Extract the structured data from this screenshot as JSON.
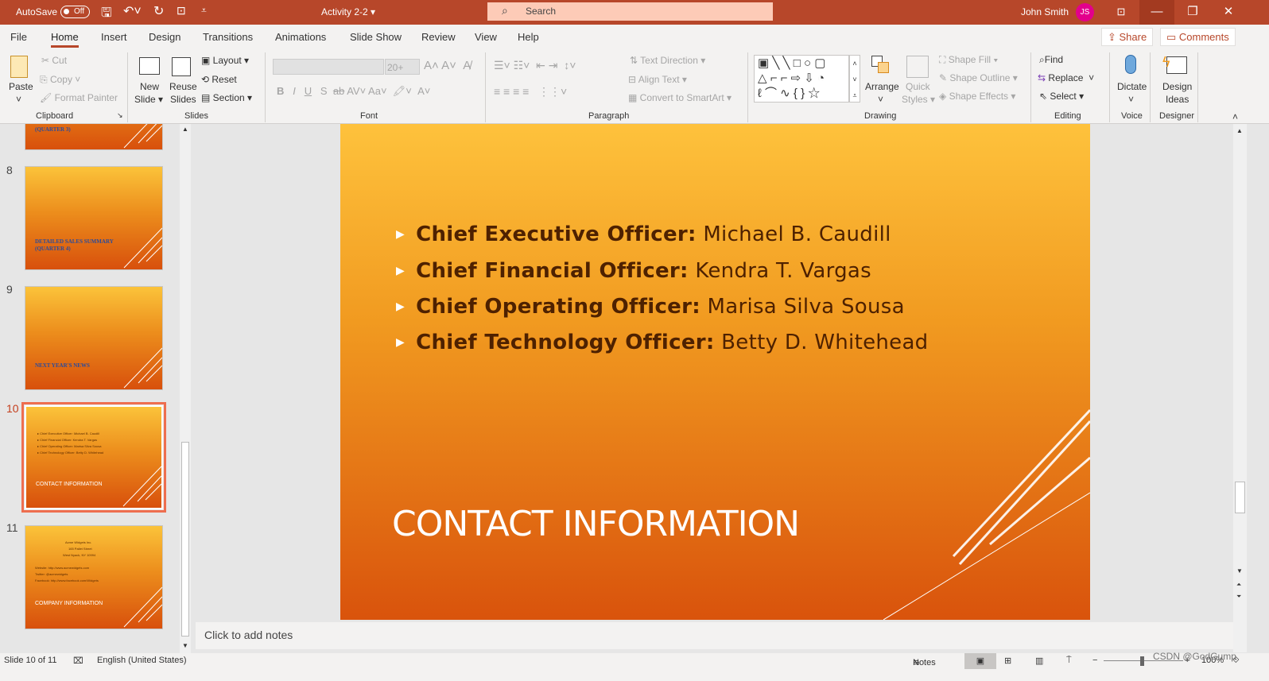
{
  "titlebar": {
    "autosave": "AutoSave",
    "autosave_state": "Off",
    "doc_title": "Activity 2-2 ▾",
    "search_placeholder": "Search",
    "user": "John Smith",
    "initials": "JS"
  },
  "tabs": [
    "File",
    "Home",
    "Insert",
    "Design",
    "Transitions",
    "Animations",
    "Slide Show",
    "Review",
    "View",
    "Help"
  ],
  "share": "Share",
  "comments": "Comments",
  "ribbon": {
    "clipboard": {
      "paste": "Paste",
      "cut": "Cut",
      "copy": "Copy",
      "format_painter": "Format Painter",
      "label": "Clipboard"
    },
    "slides": {
      "new_slide": "New",
      "new_slide2": "Slide ▾",
      "reuse": "Reuse",
      "reuse2": "Slides",
      "layout": "Layout ▾",
      "reset": "Reset",
      "section": "Section ▾",
      "label": "Slides"
    },
    "font": {
      "font_size": "20+",
      "label": "Font"
    },
    "paragraph": {
      "text_direction": "Text Direction ▾",
      "align_text": "Align Text ▾",
      "convert_smartart": "Convert to SmartArt ▾",
      "label": "Paragraph"
    },
    "drawing": {
      "arrange": "Arrange",
      "quick_styles": "Quick",
      "quick_styles2": "Styles ▾",
      "shape_fill": "Shape Fill ▾",
      "shape_outline": "Shape Outline ▾",
      "shape_effects": "Shape Effects ▾",
      "label": "Drawing"
    },
    "editing": {
      "find": "Find",
      "replace": "Replace",
      "select": "Select ▾",
      "label": "Editing"
    },
    "voice": {
      "dictate": "Dictate",
      "label": "Voice"
    },
    "designer": {
      "design_ideas": "Design",
      "design_ideas2": "Ideas",
      "label": "Designer"
    }
  },
  "thumbnails": [
    {
      "num": "",
      "title": "(QUARTER 3)"
    },
    {
      "num": "8",
      "title": "DETAILED SALES SUMMARY",
      "title2": "(QUARTER 4)"
    },
    {
      "num": "9",
      "title": "NEXT YEAR'S NEWS"
    },
    {
      "num": "10",
      "title": "CONTACT INFORMATION",
      "lines": [
        "Chief Executive Officer: Michael B. Caudill",
        "Chief Financial Officer: Kendra T. Vargas",
        "Chief Operating Officer: Marisa Silva Sousa",
        "Chief Technology Officer: Betty D. Whitehead"
      ]
    },
    {
      "num": "11",
      "title": "COMPANY INFORMATION",
      "lines": [
        "Acme Widgets Inc.",
        "165 Pallet Street",
        "West Nyack, NY 10994",
        "Website: http://www.acmewidgets.com",
        "Twitter: @acmewidgets",
        "Facebook: http://www.facebook.com/Widgets"
      ]
    }
  ],
  "slide": {
    "bullets": [
      {
        "role": "Chief Executive Officer:",
        "name": " Michael B. Caudill"
      },
      {
        "role": "Chief Financial Officer:",
        "name": " Kendra T. Vargas"
      },
      {
        "role": "Chief Operating Officer:",
        "name": " Marisa Silva Sousa"
      },
      {
        "role": "Chief Technology Officer:",
        "name": " Betty D. Whitehead"
      }
    ],
    "title": "CONTACT INFORMATION"
  },
  "notes_placeholder": "Click to add notes",
  "status": {
    "slide": "Slide 10 of 11",
    "language": "English (United States)",
    "notes": "Notes",
    "zoom": "100%",
    "watermark": "CSDN @GodGump"
  },
  "colors": {
    "accent": "#b7472a",
    "selected_thumb": "#ee6e4f"
  }
}
